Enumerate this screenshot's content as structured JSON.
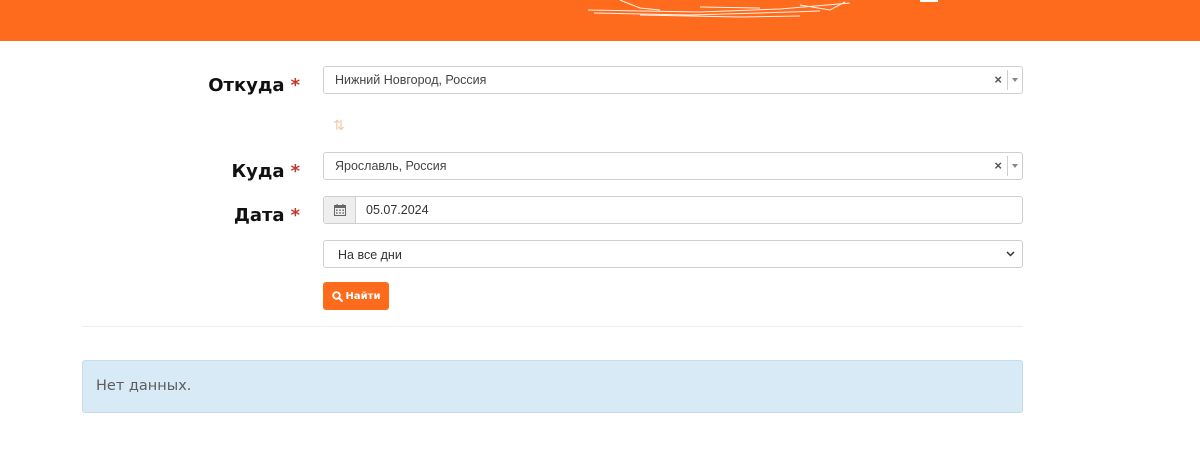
{
  "header": {
    "brand_color": "#ff6b1c"
  },
  "form": {
    "from": {
      "label": "Откуда",
      "required_mark": "*",
      "value": "Нижний Новгород, Россия",
      "clear_glyph": "×"
    },
    "swap_icon": "swap-vertical-icon",
    "to": {
      "label": "Куда",
      "required_mark": "*",
      "value": "Ярославль, Россия",
      "clear_glyph": "×"
    },
    "date": {
      "label": "Дата",
      "required_mark": "*",
      "value": "05.07.2024",
      "icon": "calendar-icon"
    },
    "days": {
      "selected": "На все дни"
    },
    "search_button": {
      "label": "Найти",
      "icon": "search-icon"
    }
  },
  "results": {
    "empty_message": "Нет данных."
  }
}
